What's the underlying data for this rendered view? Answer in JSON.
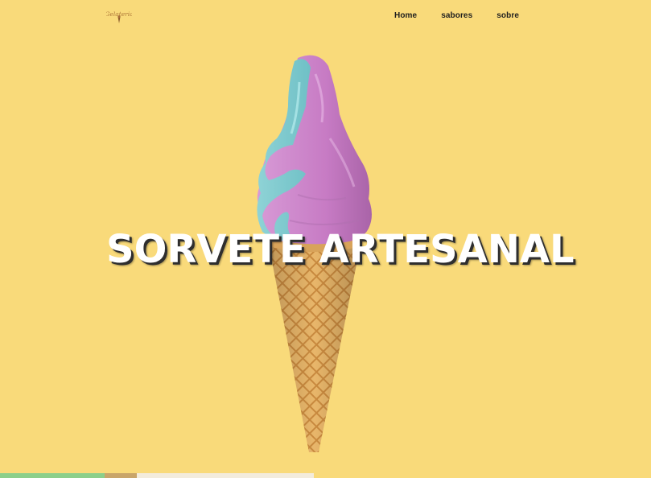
{
  "colors": {
    "background": "#f9da7a",
    "title_text": "#ffffff",
    "title_shadow": "#2e2e2e",
    "nav_text": "#1e1e1e"
  },
  "header": {
    "logo_text": "Gelateria",
    "logo_icon": "ice-cream-cone-icon",
    "nav": {
      "home_label": "Home",
      "sabores_label": "sabores",
      "sobre_label": "sobre"
    }
  },
  "hero": {
    "title": "SORVETE ARTESANAL",
    "image": "ice-cream-cone-image"
  }
}
